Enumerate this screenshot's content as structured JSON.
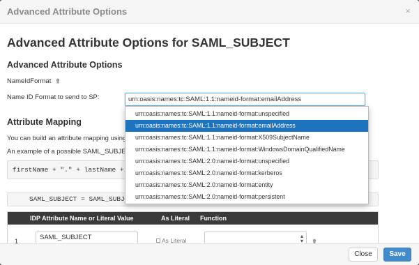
{
  "modal": {
    "title": "Advanced Attribute Options",
    "close_glyph": "×",
    "heading": "Advanced Attribute Options for SAML_SUBJECT"
  },
  "options_section": {
    "heading": "Advanced Attribute Options",
    "nameid_label": "NameIdFormat",
    "send_label": "Name ID Format to send to SP:",
    "selected_value": "urn:oasis:names:tc:SAML:1.1:nameid-format:emailAddress"
  },
  "dropdown": {
    "options": [
      "urn:oasis:names:tc:SAML:1.1:nameid-format:unspecified",
      "urn:oasis:names:tc:SAML:1.1:nameid-format:emailAddress",
      "urn:oasis:names:tc:SAML:1.1:nameid-format:X509SubjectName",
      "urn:oasis:names:tc:SAML:1.1:nameid-format:WindowsDomainQualifiedName",
      "urn:oasis:names:tc:SAML:2.0:nameid-format:unspecified",
      "urn:oasis:names:tc:SAML:2.0:nameid-format:kerberos",
      "urn:oasis:names:tc:SAML:2.0:nameid-format:entity",
      "urn:oasis:names:tc:SAML:2.0:nameid-format:persistent"
    ],
    "selected_index": 1
  },
  "mapping_section": {
    "heading": "Attribute Mapping",
    "paragraph1": "You can build an attribute mapping using",
    "paragraph2": "An example of a possible SAML_SUBJEC",
    "code_example": "firstName + \".\" + lastName + \"",
    "code_current": "SAML_SUBJECT = SAML_SUBJEC"
  },
  "table": {
    "headers": {
      "idp_attr": "IDP Attribute Name or Literal Value",
      "as_literal": "As Literal",
      "function": "Function"
    },
    "rows": [
      {
        "num": "1",
        "value": "SAML_SUBJECT",
        "literal_label": "As Literal"
      }
    ]
  },
  "footer": {
    "close_label": "Close",
    "save_label": "Save"
  },
  "colors": {
    "accent": "#428bca",
    "selected_option": "#1e73be",
    "table_header": "#3a3a3a"
  }
}
